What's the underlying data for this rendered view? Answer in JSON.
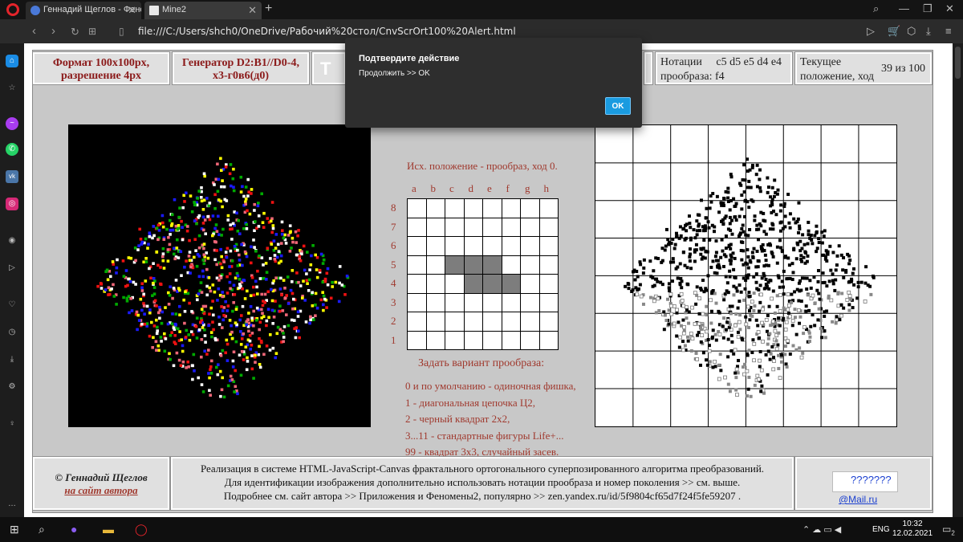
{
  "browser": {
    "tabs": [
      {
        "label": "Геннадий Щеглов - Феном"
      },
      {
        "label": "Mine2"
      }
    ],
    "url": "file:///C:/Users/shch0/OneDrive/Рабочий%20стол/CnvScrOrt100%20Alert.html"
  },
  "header": {
    "format_line1": "Формат 100x100px,",
    "format_line2": "разрешение 4px",
    "generator_line1": "Генератор D2:B1//D0-4,",
    "generator_line2": "x3-г0в6(д0)",
    "t_letter": "T",
    "notation_label_line1": "Нотации",
    "notation_value": "c5 d5 e5 d4 e4",
    "notation_label_line2": "прообраза: f4",
    "current_label_line1": "Текущее",
    "current_label_line2": "положение, ход",
    "current_value": "39 из 100"
  },
  "board": {
    "caption": "Исх. положение - прообраз, ход  0.",
    "files": [
      "a",
      "b",
      "c",
      "d",
      "e",
      "f",
      "g",
      "h"
    ],
    "ranks": [
      "8",
      "7",
      "6",
      "5",
      "4",
      "3",
      "2",
      "1"
    ],
    "filled": [
      "c5",
      "d5",
      "e5",
      "d4",
      "e4",
      "f4"
    ]
  },
  "variants": {
    "heading": "Задать вариант прообраза:",
    "items": [
      "0 и по умолчанию - одиночная фишка,",
      "1 - диагональная цепочка Ц2,",
      "2 - черный квадрат 2x2,",
      "3...11 - стандартные фигуры Life+...",
      "99 - квадрат 3x3, случайный засев."
    ]
  },
  "footer": {
    "author": "© Геннадий Щеглов",
    "author_link": "на сайт автора",
    "line1": "Реализация в системе HTML-JavaScript-Canvas фрактального ортогонального суперпозированного алгоритма преобразований.",
    "line2": "Для идентификации изображения дополнительно использовать нотации прообраза и номер поколения >> см. выше.",
    "line3": "Подробнее см. сайт автора >> Приложения и Феномены2, популярно >> zen.yandex.ru/id/5f9804cf65d7f24f5fe59207 .",
    "counter_alt": "???????",
    "counter_brand": "@Mail.ru"
  },
  "dialog": {
    "title": "Подтвердите действие",
    "message": "Продолжить >> OK",
    "ok_label": "OK"
  },
  "taskbar": {
    "lang": "ENG",
    "time": "10:32",
    "date": "12.02.2021",
    "notif_count": "2"
  },
  "colors": {
    "accent_blue": "#1a9be0",
    "opera_red": "#e3242b",
    "label_red": "#a0392e",
    "grid_fill": "#7d7d7d"
  }
}
